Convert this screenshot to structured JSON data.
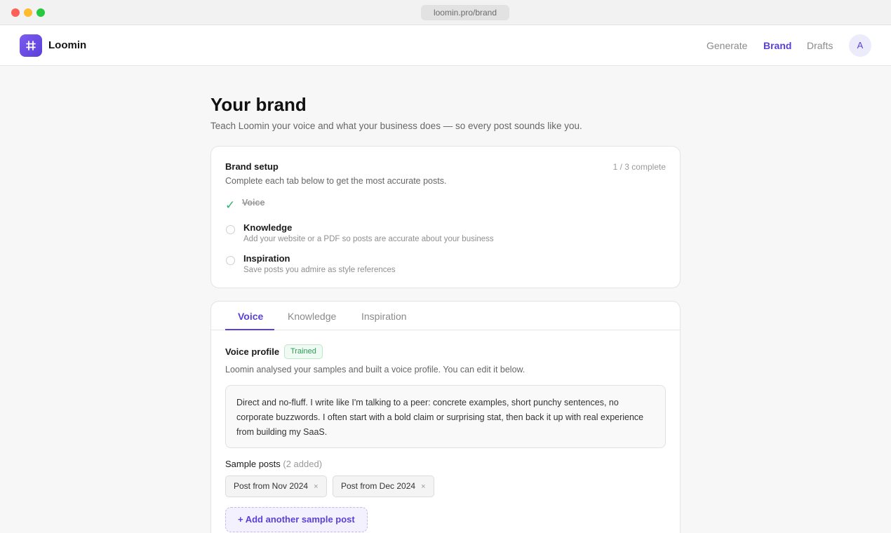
{
  "browser": {
    "url": "loomin.pro/brand"
  },
  "app": {
    "name": "Loomin",
    "nav": {
      "generate": "Generate",
      "brand": "Brand",
      "drafts": "Drafts"
    },
    "avatar_initial": "A",
    "icons": {
      "logo": "hash-grid-icon"
    }
  },
  "page": {
    "title": "Your brand",
    "subtitle": "Teach Loomin your voice and what your business does — so every post sounds like you."
  },
  "setup": {
    "title": "Brand setup",
    "progress": "1 / 3 complete",
    "description": "Complete each tab below to get the most accurate posts.",
    "steps": [
      {
        "title": "Voice",
        "description": "",
        "done": true
      },
      {
        "title": "Knowledge",
        "description": "Add your website or a PDF so posts are accurate about your business",
        "done": false
      },
      {
        "title": "Inspiration",
        "description": "Save posts you admire as style references",
        "done": false
      }
    ]
  },
  "tabs": {
    "items": [
      "Voice",
      "Knowledge",
      "Inspiration"
    ],
    "active": "Voice"
  },
  "voice": {
    "profile_title": "Voice profile",
    "status_badge": "Trained",
    "description": "Loomin analysed your samples and built a voice profile. You can edit it below.",
    "profile_text": "Direct and no-fluff. I write like I'm talking to a peer: concrete examples, short punchy sentences, no corporate buzzwords. I often start with a bold claim or surprising stat, then back it up with real experience from building my SaaS.",
    "samples_title": "Sample posts",
    "samples_count": "(2 added)",
    "samples": [
      {
        "label": "Post from Nov 2024",
        "remove": "×"
      },
      {
        "label": "Post from Dec 2024",
        "remove": "×"
      }
    ],
    "add_sample": "+ Add another sample post"
  },
  "colors": {
    "accent": "#5b3fd9",
    "success": "#2fb36a",
    "background": "#f7f7f7"
  }
}
